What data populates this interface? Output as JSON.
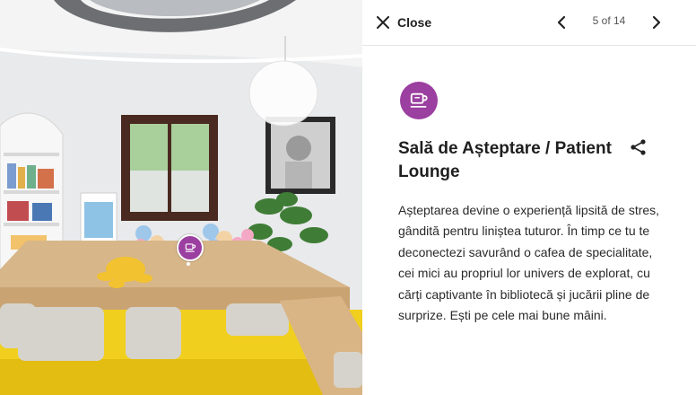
{
  "header": {
    "close_label": "Close",
    "counter": "5 of 14"
  },
  "icons": {
    "close": "close-icon",
    "prev": "chevron-left-icon",
    "next": "chevron-right-icon",
    "category": "coffee-cup-icon",
    "share": "share-icon",
    "hotspot": "coffee-cup-icon"
  },
  "detail": {
    "title": "Sală de Așteptare / Patient Lounge",
    "description": "Așteptarea devine o experiență lipsită de stres, gândită pentru liniștea tuturor. În timp ce tu te deconectezi savurând o cafea de specialitate, cei mici au propriul lor univers de explorat, cu cărți captivante în bibliotecă și jucării pline de surprize. Ești pe cele mai bune mâini."
  },
  "colors": {
    "accent": "#9b3fa0",
    "text": "#1f1f1f"
  }
}
